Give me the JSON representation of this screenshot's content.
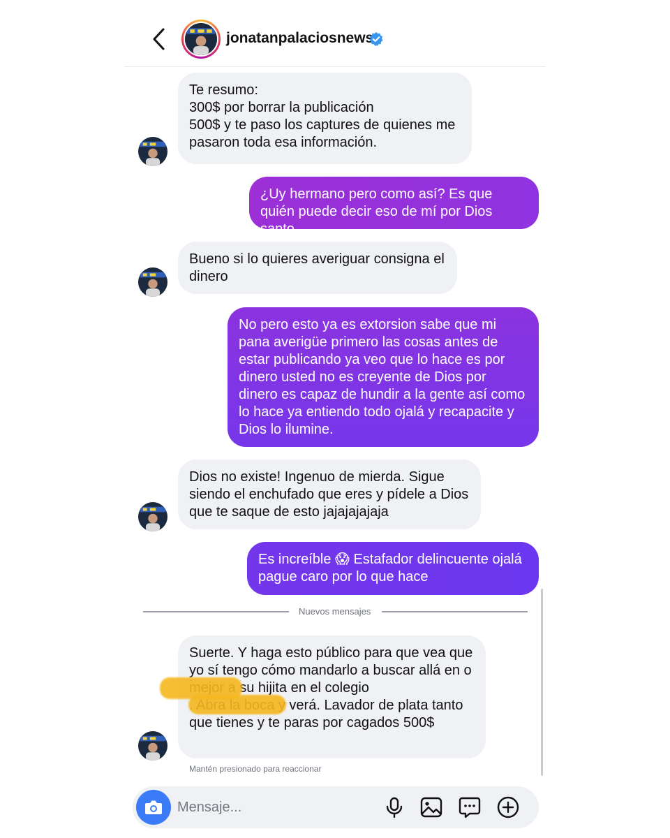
{
  "header": {
    "username": "jonatanpalaciosnews"
  },
  "messages": [
    {
      "direction": "received",
      "text": "Te resumo:\n300$ por borrar la publicación\n500$ y te paso los captures de quienes me pasaron toda esa información."
    },
    {
      "direction": "sent",
      "text": "¿Uy hermano pero como así? Es que quién puede decir eso de mí por Dios santo"
    },
    {
      "direction": "received",
      "text": "Bueno si lo quieres averiguar consigna el dinero"
    },
    {
      "direction": "sent",
      "text": "No pero esto ya es extorsion sabe que mi pana averigüe primero las cosas antes de estar publicando ya veo que lo hace es por dinero usted no es creyente de Dios por dinero es capaz de hundir a la gente así como lo hace ya entiendo todo ojalá y recapacite y Dios lo ilumine."
    },
    {
      "direction": "received",
      "text": "Dios no existe! Ingenuo de mierda. Sigue siendo el enchufado que eres y pídele a Dios que te saque de esto jajajajajaja"
    },
    {
      "direction": "sent",
      "text": "Es increíble 😱 Estafador delincuente ojalá pague caro por lo que hace"
    },
    {
      "direction": "received",
      "text": "Suerte. Y haga esto público para que vea que yo sí tengo cómo mandarlo a buscar allá en \t\t\to mejor a su hijita en el colegio\n\t\t\t. Abra la boca y verá. Lavador de plata tanto que tienes y te paras por cagados 500$"
    }
  ],
  "new_messages_label": "Nuevos mensajes",
  "reaction_hint": "Mantén presionado para reaccionar",
  "composer": {
    "placeholder": "Mensaje..."
  },
  "icons": {
    "back": "chevron-left-icon",
    "verified": "verified-badge-icon",
    "camera": "camera-icon",
    "microphone": "microphone-icon",
    "gallery": "image-icon",
    "sticker": "chat-sticker-icon",
    "add": "plus-circle-icon"
  },
  "colors": {
    "received_bubble": "#eff1f4",
    "sent_gradient_start": "#9c2fd6",
    "sent_gradient_end": "#6f36f0",
    "verified": "#3897f0",
    "camera_button": "#3b7bf7",
    "censor": "#f5b71f"
  }
}
